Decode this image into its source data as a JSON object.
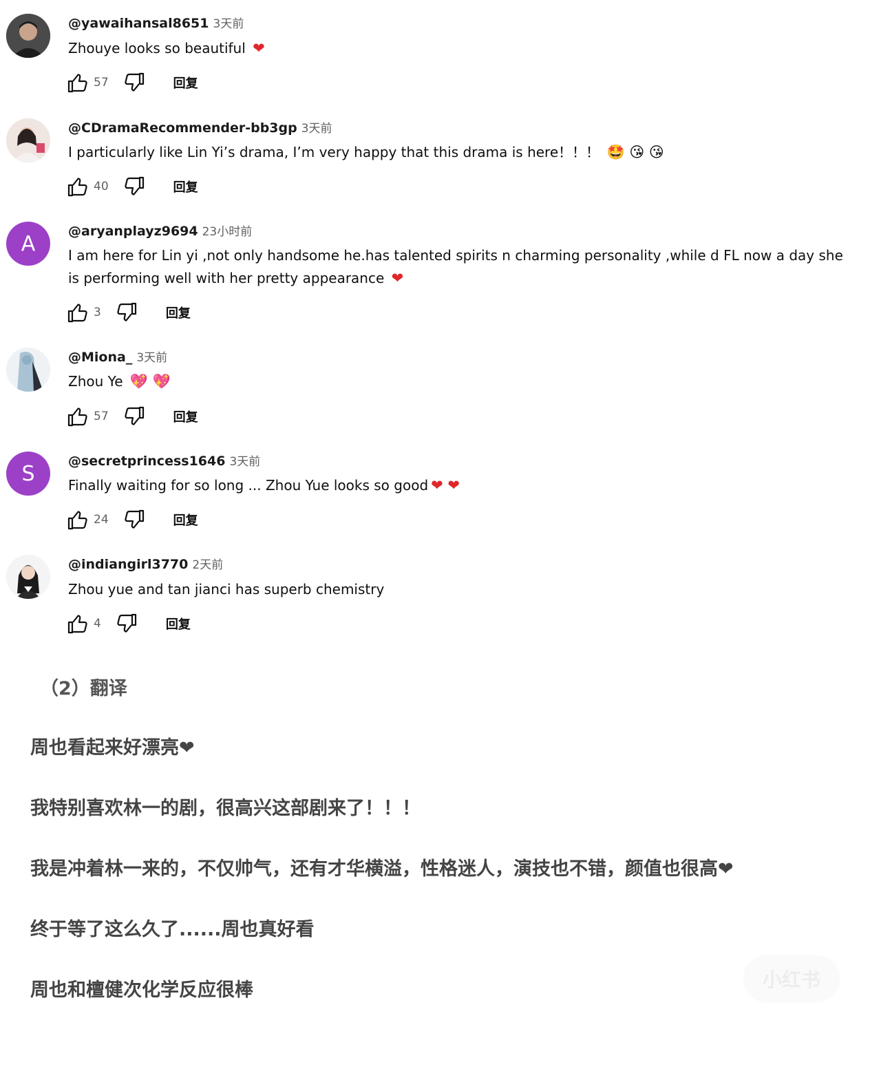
{
  "comments": [
    {
      "author": "@yawaihansal8651",
      "time": "3天前",
      "text": "Zhouye looks so beautiful",
      "emoji": "❤",
      "likes": "57",
      "reply": "回复"
    },
    {
      "author": "@CDramaRecommender-bb3gp",
      "time": "3天前",
      "text": "I particularly like Lin Yi’s drama, I’m very happy that this drama is here！！！",
      "emoji": "🤩 😘 😘",
      "likes": "40",
      "reply": "回复"
    },
    {
      "author": "@aryanplayz9694",
      "time": "23小时前",
      "avatar_letter": "A",
      "text": "I am here for Lin yi ,not only handsome he.has talented spirits n charming personality ,while d FL now a day she is performing well with her pretty appearance",
      "emoji": "❤",
      "likes": "3",
      "reply": "回复"
    },
    {
      "author": "@Miona_",
      "time": "3天前",
      "text": "Zhou Ye",
      "emoji": "💖 💖",
      "likes": "57",
      "reply": "回复"
    },
    {
      "author": "@secretprincess1646",
      "time": "3天前",
      "avatar_letter": "S",
      "text": "Finally waiting for so long ... Zhou Yue looks so good",
      "emoji": "❤ ❤",
      "likes": "24",
      "reply": "回复"
    },
    {
      "author": "@indiangirl3770",
      "time": "2天前",
      "text": "Zhou yue and tan jianci has superb chemistry",
      "emoji": "",
      "likes": "4",
      "reply": "回复"
    }
  ],
  "translation": {
    "title": "（2）翻译",
    "lines": [
      "周也看起来好漂亮❤",
      "我特别喜欢林一的剧，很高兴这部剧来了！！！",
      "我是冲着林一来的，不仅帅气，还有才华横溢，性格迷人，演技也不错，颜值也很高❤",
      "终于等了这么久了......周也真好看",
      "周也和檀健次化学反应很棒"
    ]
  },
  "watermark": "小红书",
  "colors": {
    "avatar_purple": "#9c40c8",
    "heart": "#e0262b",
    "muted": "#606060"
  }
}
